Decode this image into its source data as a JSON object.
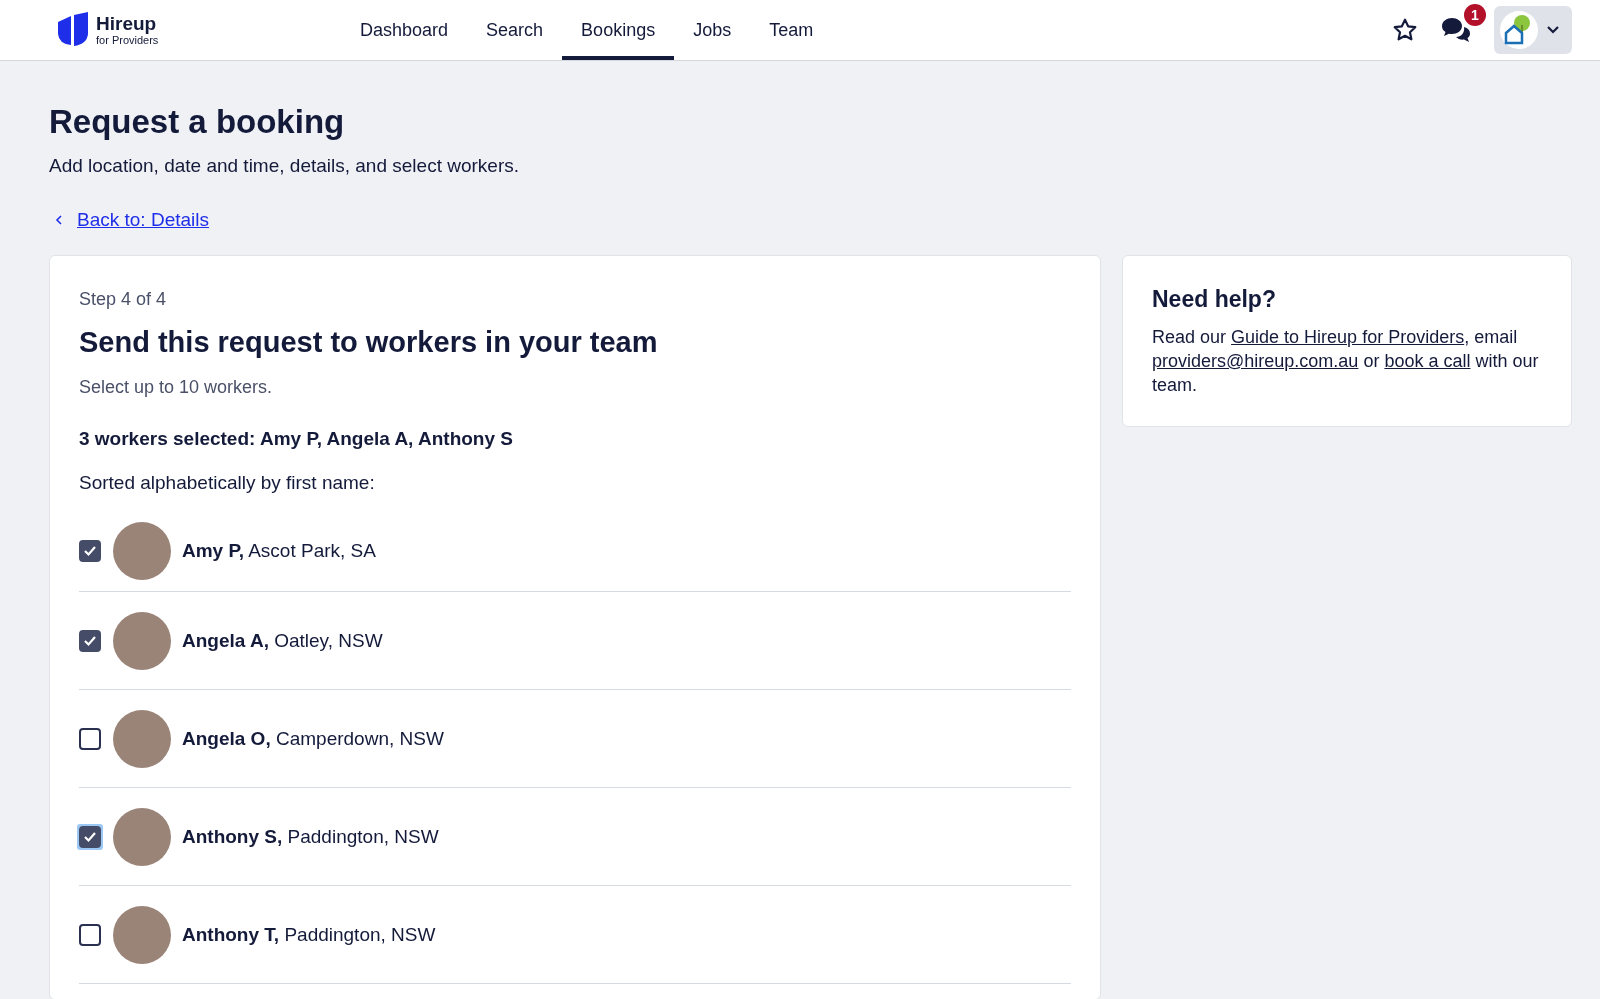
{
  "brand": {
    "name": "Hireup",
    "tagline": "for Providers"
  },
  "nav": [
    {
      "label": "Dashboard",
      "selected": false
    },
    {
      "label": "Search",
      "selected": false
    },
    {
      "label": "Bookings",
      "selected": true
    },
    {
      "label": "Jobs",
      "selected": false
    },
    {
      "label": "Team",
      "selected": false
    }
  ],
  "messages_badge": "1",
  "page": {
    "title": "Request a booking",
    "subtitle": "Add location, date and time, details, and select workers.",
    "back_link": "Back to: Details"
  },
  "step": {
    "label": "Step 4 of 4",
    "title": "Send this request to workers in your team",
    "hint": "Select up to 10 workers.",
    "summary": "3 workers selected: Amy P, Angela A, Anthony S",
    "sort_note": "Sorted alphabetically by first name:",
    "workers": [
      {
        "name": "Amy P,",
        "location": "Ascot Park, SA",
        "checked": true,
        "focused": false
      },
      {
        "name": "Angela A,",
        "location": "Oatley, NSW",
        "checked": true,
        "focused": false
      },
      {
        "name": "Angela O,",
        "location": "Camperdown, NSW",
        "checked": false,
        "focused": false
      },
      {
        "name": "Anthony S,",
        "location": "Paddington, NSW",
        "checked": true,
        "focused": true
      },
      {
        "name": "Anthony T,",
        "location": "Paddington, NSW",
        "checked": false,
        "focused": false
      }
    ]
  },
  "help": {
    "title": "Need help?",
    "parts": [
      {
        "kind": "text",
        "text": "Read our "
      },
      {
        "kind": "link",
        "text": "Guide to Hireup for Providers"
      },
      {
        "kind": "text",
        "text": ", email "
      },
      {
        "kind": "link",
        "text": "providers@hireup.com.au"
      },
      {
        "kind": "text",
        "text": " or "
      },
      {
        "kind": "link",
        "text": "book a call"
      },
      {
        "kind": "text",
        "text": " with our team."
      }
    ]
  }
}
